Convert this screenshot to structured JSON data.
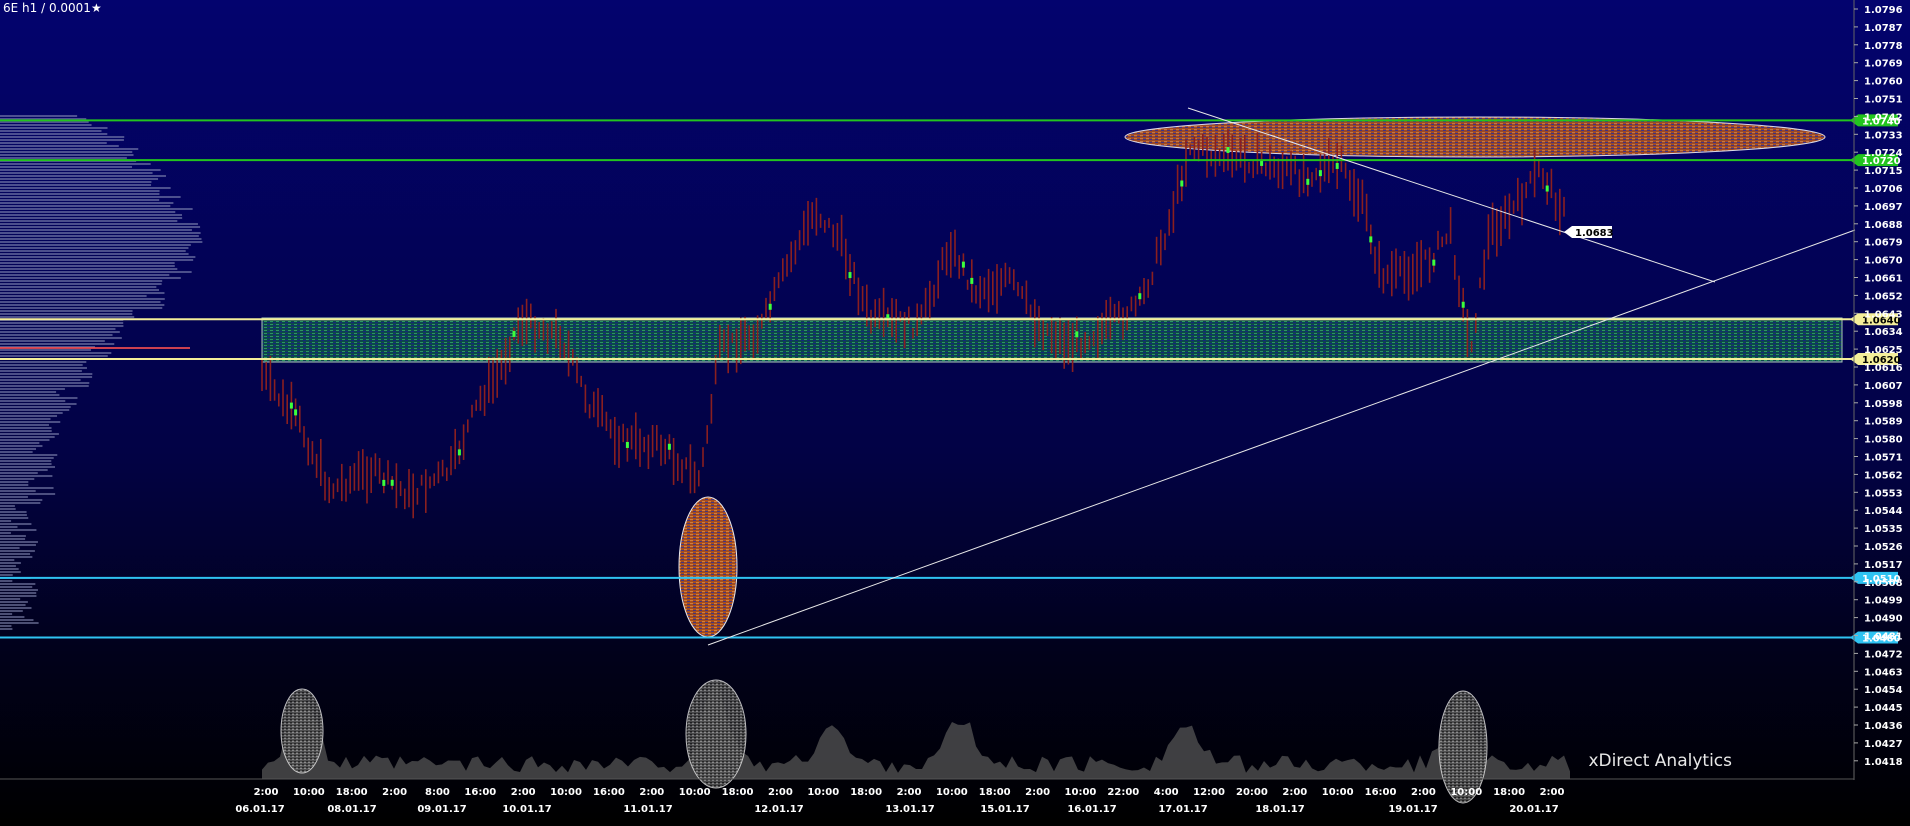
{
  "header": {
    "instrument": "6E h1 / 0.0001",
    "star": "★"
  },
  "brand": "xDirect Analytics",
  "colors": {
    "bg_top": "#03036e",
    "bg_bottom": "#000000",
    "green_line": "#22c41e",
    "yellow_line": "#f4ee9a",
    "blue_line": "#2fc3f2",
    "candle": "#8a1f1f",
    "candle_highlight": "#3cff3c",
    "zone_green": "#1c7a3e",
    "zone_orange": "#d2651f"
  },
  "chart_data": {
    "type": "candlestick",
    "ylim": [
      1.0412,
      1.08
    ],
    "y_ticks": [
      "1.0796",
      "1.0787",
      "1.0778",
      "1.0769",
      "1.0760",
      "1.0751",
      "1.0742",
      "1.0733",
      "1.0724",
      "1.0715",
      "1.0706",
      "1.0697",
      "1.0688",
      "1.0679",
      "1.0670",
      "1.0661",
      "1.0652",
      "1.0643",
      "1.0634",
      "1.0625",
      "1.0616",
      "1.0607",
      "1.0598",
      "1.0589",
      "1.0580",
      "1.0571",
      "1.0562",
      "1.0553",
      "1.0544",
      "1.0535",
      "1.0526",
      "1.0517",
      "1.0508",
      "1.0499",
      "1.0490",
      "1.0481",
      "1.0472",
      "1.0463",
      "1.0454",
      "1.0445",
      "1.0436",
      "1.0427",
      "1.0418"
    ],
    "x_time_labels": [
      "2:00",
      "10:00",
      "18:00",
      "2:00",
      "8:00",
      "16:00",
      "2:00",
      "10:00",
      "16:00",
      "2:00",
      "10:00",
      "18:00",
      "2:00",
      "10:00",
      "18:00",
      "2:00",
      "10:00",
      "18:00",
      "2:00",
      "10:00",
      "22:00",
      "4:00",
      "12:00",
      "20:00",
      "2:00",
      "10:00",
      "16:00",
      "2:00",
      "10:00",
      "18:00",
      "2:00"
    ],
    "x_date_labels": [
      "06.01.17",
      "08.01.17",
      "09.01.17",
      "10.01.17",
      "11.01.17",
      "12.01.17",
      "13.01.17",
      "15.01.17",
      "16.01.17",
      "17.01.17",
      "18.01.17",
      "19.01.17",
      "20.01.17"
    ],
    "levels": [
      {
        "value": 1.074,
        "label": "1.0740",
        "kind": "green"
      },
      {
        "value": 1.072,
        "label": "1.0720",
        "kind": "green"
      },
      {
        "value": 1.064,
        "label": "1.0640",
        "kind": "yellow"
      },
      {
        "value": 1.062,
        "label": "1.0620",
        "kind": "yellow"
      },
      {
        "value": 1.051,
        "label": "1.0510",
        "kind": "blue"
      },
      {
        "value": 1.048,
        "label": "1.0480",
        "kind": "blue"
      }
    ],
    "current_price_label": "1.0683"
  }
}
